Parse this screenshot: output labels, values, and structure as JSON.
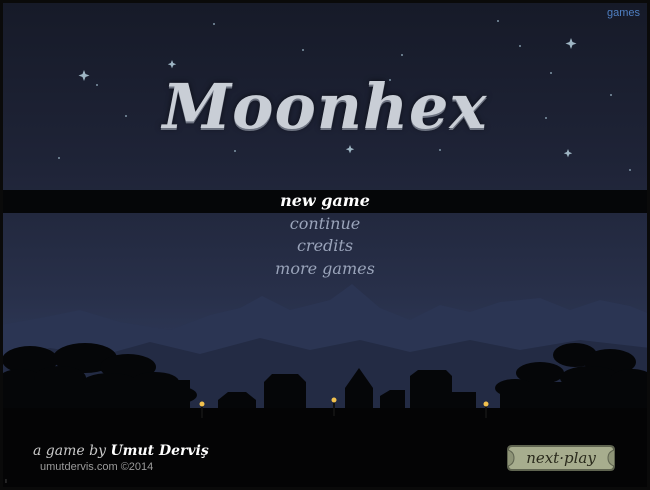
{
  "top_link": "games",
  "logo": "Moonhex",
  "menu": {
    "items": [
      {
        "label": "new game",
        "selected": true
      },
      {
        "label": "continue",
        "selected": false
      },
      {
        "label": "credits",
        "selected": false
      },
      {
        "label": "more games",
        "selected": false
      }
    ]
  },
  "footer": {
    "credit_prefix": "a game by",
    "author": "Umut Derviş",
    "site": "umutdervis.com ©2014",
    "sponsor_button": "next·play"
  },
  "colors": {
    "sky_top": "#161a28",
    "sky_mid": "#28304a",
    "menu_selected": "#ffffff",
    "menu_item": "#9aa4ba",
    "link": "#4f7fc2",
    "torch": "#f2c14e"
  },
  "icons": [
    "star-icon",
    "torch-icon",
    "scroll-banner-icon"
  ]
}
